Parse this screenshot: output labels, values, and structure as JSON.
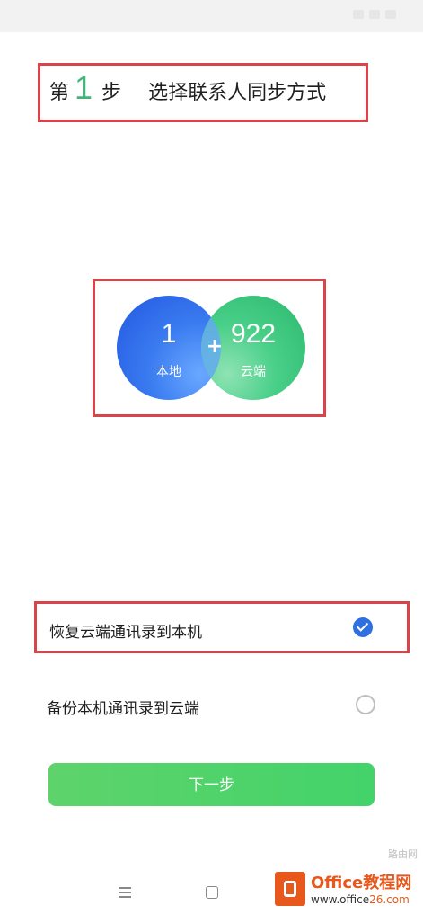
{
  "header": {
    "step_prefix": "第",
    "step_number": "1",
    "step_suffix": "步",
    "title": "选择联系人同步方式"
  },
  "sync_summary": {
    "local": {
      "count": "1",
      "label": "本地"
    },
    "cloud": {
      "count": "922",
      "label": "云端"
    },
    "plus": "+"
  },
  "options": [
    {
      "label": "恢复云端通讯录到本机",
      "selected": true
    },
    {
      "label": "备份本机通讯录到云端",
      "selected": false
    }
  ],
  "next_button": {
    "label": "下一步"
  },
  "watermark": {
    "brand": "Office教程网",
    "url_head": "www.office",
    "url_tail": "26.com",
    "corner": "路由网"
  },
  "colors": {
    "accent_green": "#3fb57a",
    "button_green": "#4cd46b",
    "check_blue": "#2f6fe0",
    "highlight_red": "#d9434a",
    "local_blue": "#3a7bf0",
    "cloud_green": "#48cf88"
  },
  "icons": {
    "check_selected": "check-circle-icon",
    "check_unselected": "empty-circle-icon",
    "nav_menu": "menu-icon",
    "nav_home": "home-square-icon",
    "watermark_logo": "office-logo-icon"
  }
}
